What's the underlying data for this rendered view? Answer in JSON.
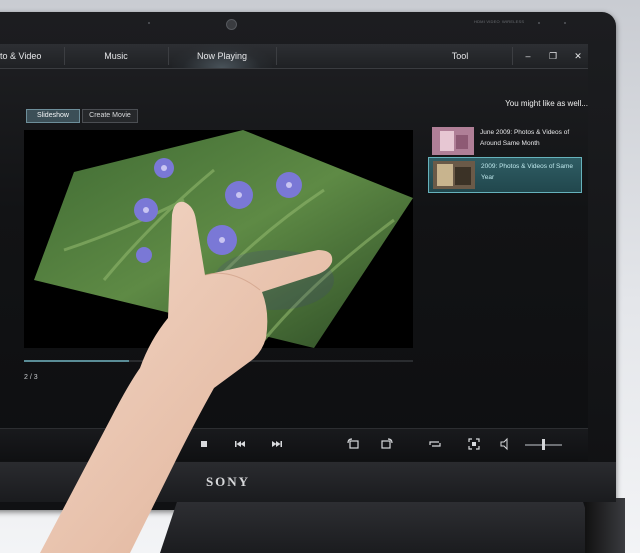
{
  "nav": {
    "items": [
      {
        "label": "to & Video"
      },
      {
        "label": "Music"
      },
      {
        "label": "Now Playing",
        "active": true
      },
      {
        "label": "Tool"
      }
    ]
  },
  "window_controls": {
    "minimize": "–",
    "restore": "❐",
    "close": "✕"
  },
  "modes": {
    "slideshow": "Slideshow",
    "create_movie": "Create Movie",
    "active": "slideshow"
  },
  "suggestions": {
    "header": "You might like as well...",
    "items": [
      {
        "title": "June 2009: Photos & Videos of Around Same Month",
        "selected": false
      },
      {
        "title": "2009: Photos & Videos of Same Year",
        "selected": true
      }
    ]
  },
  "slideshow": {
    "counter": "2 / 3",
    "progress": 0.27
  },
  "controls": {
    "icons": [
      "stop-icon",
      "previous-icon",
      "next-icon",
      "rotate-left-icon",
      "rotate-right-icon",
      "repeat-icon",
      "fullscreen-icon",
      "volume-icon"
    ],
    "volume": 0.45
  },
  "hardware": {
    "brand": "SONY",
    "label_left": "HDMI VIDEO",
    "label_mid": "WIRELESS"
  },
  "colors": {
    "accent": "#66b2bc",
    "selected_bg": "#2f5d64",
    "screen_bg": "#121315"
  }
}
